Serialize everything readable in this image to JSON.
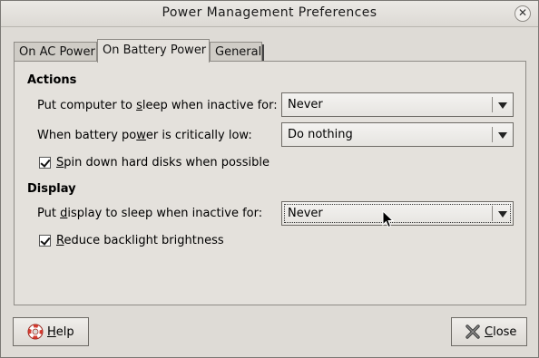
{
  "window": {
    "title": "Power Management Preferences"
  },
  "tabs": [
    {
      "label": "On AC Power"
    },
    {
      "label": "On Battery Power",
      "active": true
    },
    {
      "label": "General"
    }
  ],
  "actions": {
    "heading": "Actions",
    "sleep_label_pre": "Put computer to ",
    "sleep_label_u": "s",
    "sleep_label_post": "leep when inactive for:",
    "sleep_value": "Never",
    "critical_label_pre": "When battery po",
    "critical_label_u": "w",
    "critical_label_post": "er is critically low:",
    "critical_value": "Do nothing",
    "spin_u": "S",
    "spin_label": "pin down hard disks when possible",
    "spin_checked": true
  },
  "display": {
    "heading": "Display",
    "sleep_label_pre": "Put ",
    "sleep_label_u": "d",
    "sleep_label_post": "isplay to sleep when inactive for:",
    "sleep_value": "Never",
    "backlight_u": "R",
    "backlight_label": "educe backlight brightness",
    "backlight_checked": true
  },
  "buttons": {
    "help_u": "H",
    "help_label": "elp",
    "close_u": "C",
    "close_label": "lose"
  },
  "icons": {
    "close": "close-icon",
    "help": "lifebuoy-icon",
    "dialog_close": "x-icon",
    "dropdown": "triangle-down-icon"
  }
}
